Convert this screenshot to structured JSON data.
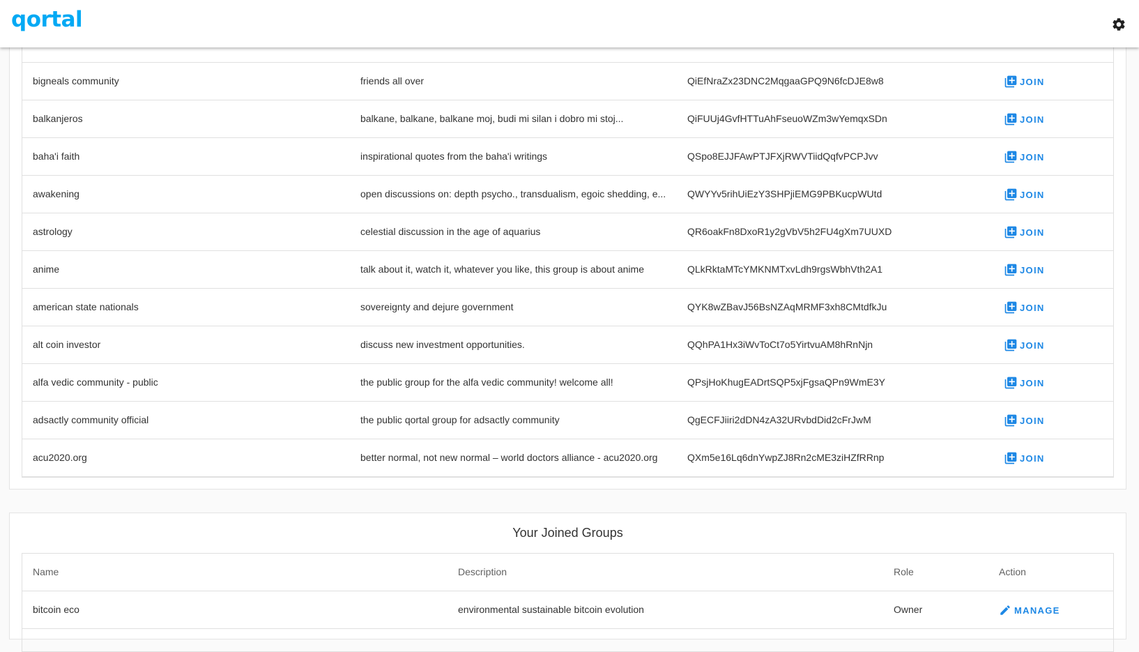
{
  "app": {
    "logo_text": "qortal",
    "settings_icon": "gear-icon"
  },
  "colors": {
    "accent": "#1e88e5",
    "logo": "#03a9f4"
  },
  "public_groups": {
    "action_label": "JOIN",
    "rows": [
      {
        "name": "bigneals community",
        "description": "friends all over",
        "address": "QiEfNraZx23DNC2MqgaaGPQ9N6fcDJE8w8"
      },
      {
        "name": "balkanjeros",
        "description": "balkane, balkane, balkane moj, budi mi silan i dobro mi stoj...",
        "address": "QiFUUj4GvfHTTuAhFseuoWZm3wYemqxSDn"
      },
      {
        "name": "baha'i faith",
        "description": "inspirational quotes from the baha'i writings",
        "address": "QSpo8EJJFAwPTJFXjRWVTiidQqfvPCPJvv"
      },
      {
        "name": "awakening",
        "description": "open discussions on: depth psycho., transdualism, egoic shedding, e...",
        "address": "QWYYv5rihUiEzY3SHPjiEMG9PBKucpWUtd"
      },
      {
        "name": "astrology",
        "description": "celestial discussion in the age of aquarius",
        "address": "QR6oakFn8DxoR1y2gVbV5h2FU4gXm7UUXD"
      },
      {
        "name": "anime",
        "description": "talk about it, watch it, whatever you like, this group is about anime",
        "address": "QLkRktaMTcYMKNMTxvLdh9rgsWbhVth2A1"
      },
      {
        "name": "american state nationals",
        "description": "sovereignty and dejure government",
        "address": "QYK8wZBavJ56BsNZAqMRMF3xh8CMtdfkJu"
      },
      {
        "name": "alt coin investor",
        "description": "discuss new investment opportunities.",
        "address": "QQhPA1Hx3iWvToCt7o5YirtvuAM8hRnNjn"
      },
      {
        "name": "alfa vedic community - public",
        "description": "the public group for the alfa vedic community! welcome all!",
        "address": "QPsjHoKhugEADrtSQP5xjFgsaQPn9WmE3Y"
      },
      {
        "name": "adsactly community official",
        "description": "the public qortal group for adsactly community",
        "address": "QgECFJiiri2dDN4zA32URvbdDid2cFrJwM"
      },
      {
        "name": "acu2020.org",
        "description": "better normal, not new normal – world doctors alliance - acu2020.org",
        "address": "QXm5e16Lq6dnYwpZJ8Rn2cME3ziHZfRRnp"
      }
    ]
  },
  "joined_groups": {
    "title": "Your Joined Groups",
    "headers": {
      "name": "Name",
      "description": "Description",
      "role": "Role",
      "action": "Action"
    },
    "rows": [
      {
        "name": "bitcoin eco",
        "description": "environmental sustainable bitcoin evolution",
        "role": "Owner",
        "action": "MANAGE"
      }
    ]
  }
}
